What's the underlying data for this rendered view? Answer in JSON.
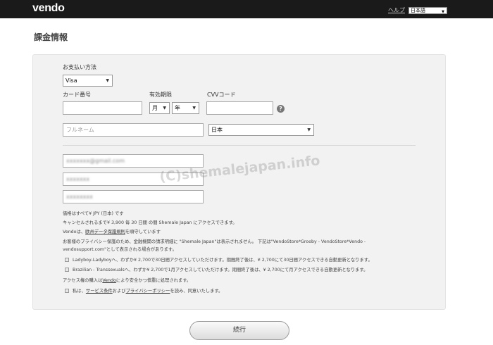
{
  "header": {
    "logo": "vendo",
    "help_link": "ヘルプ",
    "language": "日本語"
  },
  "page_title": "課金情報",
  "form": {
    "payment_method_label": "お支払い方法",
    "payment_method_value": "Visa",
    "card_number_label": "カード番号",
    "expiry_label": "有効期限",
    "month_value": "月",
    "year_value": "年",
    "cvv_label": "CVVコード",
    "help_icon": "?",
    "fullname_placeholder": "フルネーム",
    "country_value": "日本",
    "email_value": "xxxxxxx@gmail.com",
    "field2_value": "xxxxxxx",
    "field3_value": "xxxxxxxx"
  },
  "notes": {
    "line1": "価格はすべて¥ JPY (日本) です",
    "line2": "キャンセルされるまで¥ 3,900 毎 30 日間 の間 Shemale Japan にアクセスできます。",
    "line3_pre": "Vendoは、",
    "line3_link": "欧州データ保護規則",
    "line3_post": "を順守しています",
    "line4": "お客様のプライバシー保護のため、金融機関の請求明細に \"Shemale Japan\"は表示されません。 下記は\"VendoStore*Grooby - VendoStore*Vendo -",
    "line5": "vendosupport.com\"として表示される場合があります。",
    "offer1": "Ladyboy-Ladyboyへ、わずか¥ 2,700で30日間アクセスしていただけます。期間終了後は、¥ 2,700にて30日間アクセスできる自動更新となります。",
    "offer2": "Brazilian - Transsexualsへ、わずか¥ 2,700で1月アクセスしていただけます。期間終了後は、¥ 2,700にて月アクセスできる自動更新となります。",
    "line6_pre": "アクセス権の購入は",
    "line6_link": "Vendo",
    "line6_post": "により安全かつ慎重に処理されます。",
    "terms_pre": "私は、",
    "terms_link1": "サービス条件",
    "terms_mid": "および",
    "terms_link2": "プライバシーポリシー",
    "terms_post": "を読み、同意いたします。"
  },
  "watermark": "(C)shemalejapan.info",
  "continue_button": "続行"
}
